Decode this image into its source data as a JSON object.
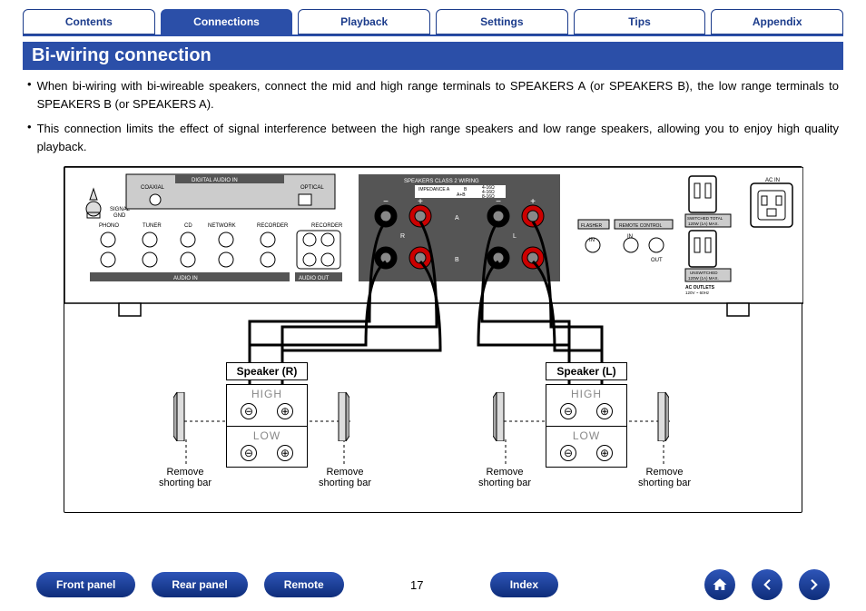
{
  "tabs": {
    "items": [
      {
        "label": "Contents",
        "active": false
      },
      {
        "label": "Connections",
        "active": true
      },
      {
        "label": "Playback",
        "active": false
      },
      {
        "label": "Settings",
        "active": false
      },
      {
        "label": "Tips",
        "active": false
      },
      {
        "label": "Appendix",
        "active": false
      }
    ]
  },
  "section_title": "Bi-wiring connection",
  "body": {
    "p1": "When bi-wiring with bi-wireable speakers, connect the mid and high range terminals to SPEAKERS A (or SPEAKERS B), the low range terminals to SPEAKERS B (or SPEAKERS A).",
    "p2": "This connection limits the effect of signal interference between the high range speakers and low range speakers, allowing you to enjoy high quality playback."
  },
  "panel_labels": {
    "digital_audio_in": "DIGITAL AUDIO IN",
    "coaxial": "COAXIAL",
    "optical": "OPTICAL",
    "signal_gnd": "SIGNAL\nGND",
    "phono": "PHONO",
    "tuner": "TUNER",
    "cd": "CD",
    "network": "NETWORK",
    "recorder": "RECORDER",
    "audio_in": "AUDIO IN",
    "audio_out": "AUDIO OUT",
    "speakers": "SPEAKERS   CLASS 2 WIRING",
    "impedance": "IMPEDANCE A\nB\nA+B",
    "imp_values": "4-16Ω\n4-16Ω\n8-16Ω",
    "a": "A",
    "b": "B",
    "r": "R",
    "l": "L",
    "flasher": "FLASHER",
    "remote_control": "REMOTE CONTROL",
    "in": "IN",
    "out": "OUT",
    "switched_total": "SWITCHED TOTAL\n120W (1A) MAX.",
    "unswitched": "UNSWITCHED\n120W (1A) MAX.",
    "ac_outlets": "AC OUTLETS\n120V ~ 60Hz",
    "ac_in": "AC IN"
  },
  "speakers": {
    "right": "Speaker (R)",
    "left": "Speaker (L)",
    "high": "HIGH",
    "low": "LOW",
    "minus": "−",
    "plus": "+",
    "shorting": "Remove\nshorting bar"
  },
  "page_number": "17",
  "footer": {
    "front": "Front panel",
    "rear": "Rear panel",
    "remote": "Remote",
    "index": "Index"
  }
}
